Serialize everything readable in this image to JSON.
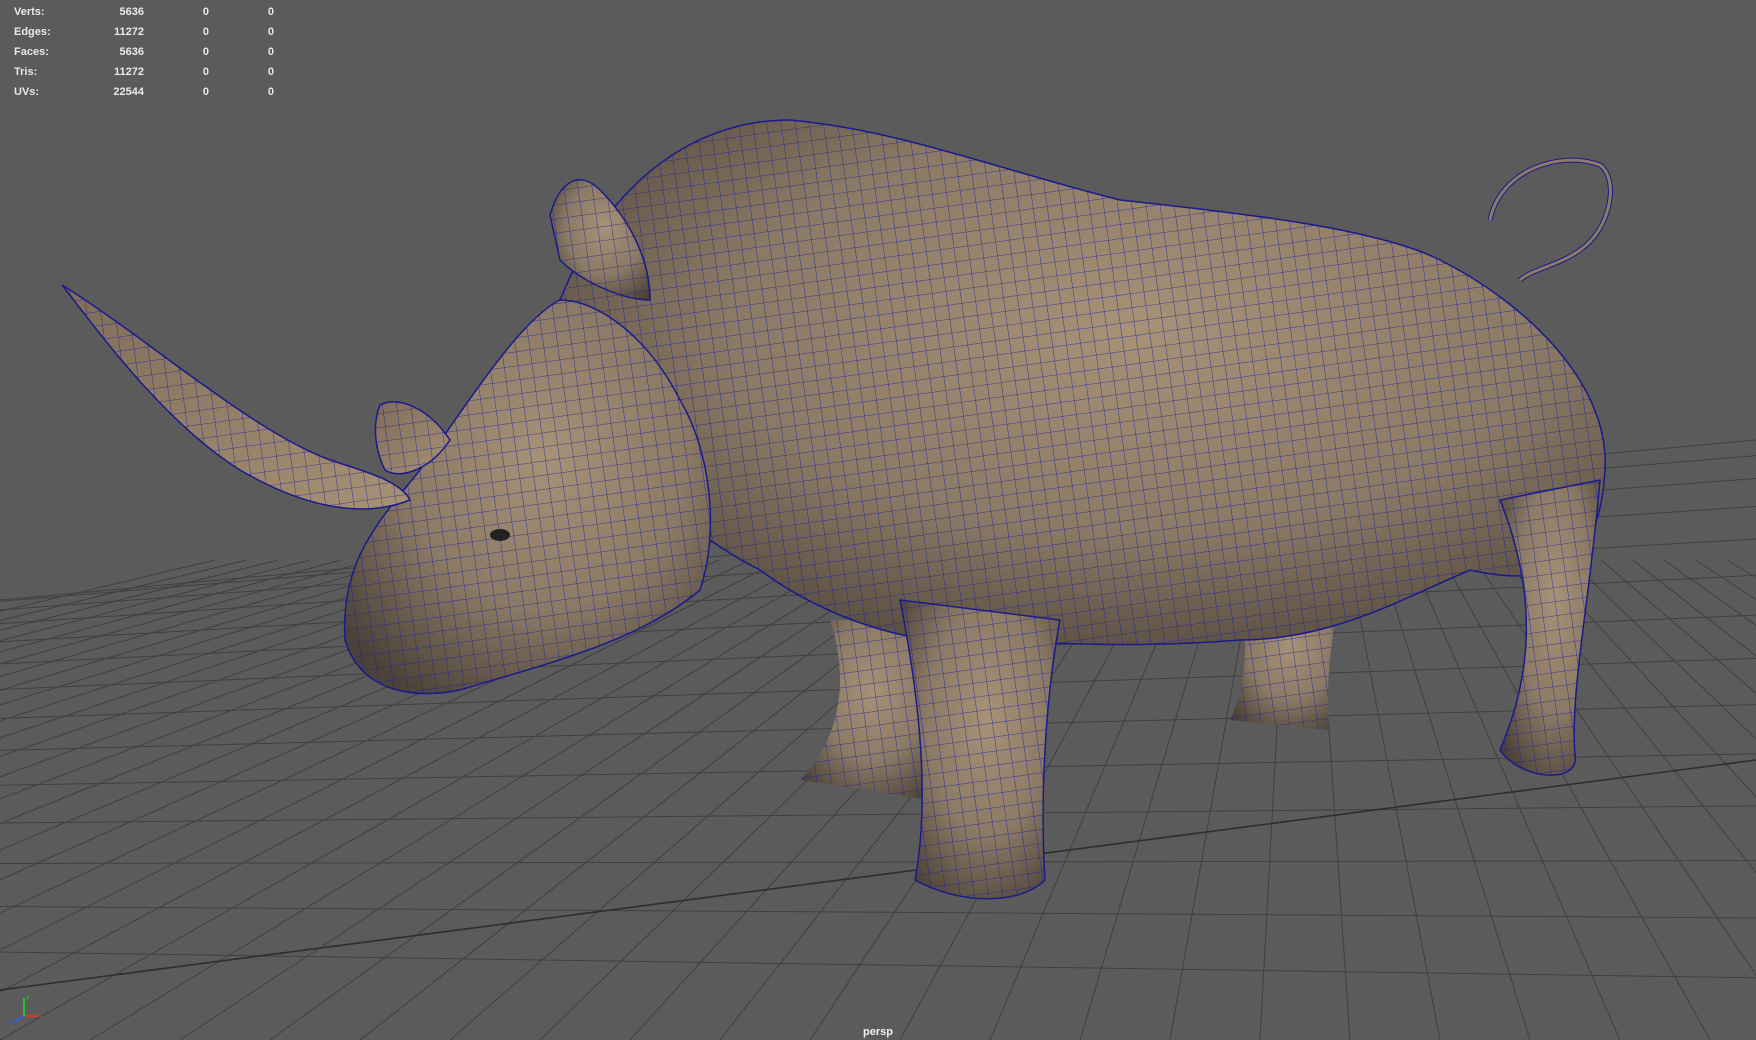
{
  "hud": {
    "rows": [
      {
        "label": "Verts:",
        "value": "5636",
        "selected": "0",
        "triangles": "0"
      },
      {
        "label": "Edges:",
        "value": "11272",
        "selected": "0",
        "triangles": "0"
      },
      {
        "label": "Faces:",
        "value": "5636",
        "selected": "0",
        "triangles": "0"
      },
      {
        "label": "Tris:",
        "value": "11272",
        "selected": "0",
        "triangles": "0"
      },
      {
        "label": "UVs:",
        "value": "22544",
        "selected": "0",
        "triangles": "0"
      }
    ]
  },
  "viewport": {
    "camera_label": "persp",
    "background_color": "#5b5b5b",
    "grid_color": "#3c3c3c",
    "wireframe_color": "#1a1a8c",
    "model_color": "#8a7a66"
  },
  "axis_gizmo": {
    "x_label": "x",
    "y_label": "y",
    "z_label": "z"
  }
}
